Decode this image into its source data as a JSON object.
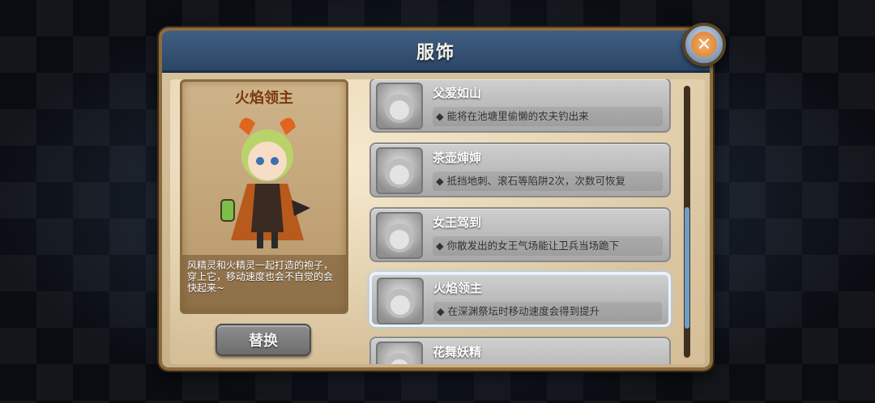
{
  "dialog": {
    "title": "服饰",
    "close_label": "✕"
  },
  "preview": {
    "name": "火焰领主",
    "description": "风精灵和火精灵一起打造的袍子，穿上它，移动速度也会不自觉的会快起来~"
  },
  "buttons": {
    "replace": "替换"
  },
  "items": [
    {
      "name": "父爱如山",
      "desc": "◆ 能将在池塘里偷懒的农夫钓出来"
    },
    {
      "name": "茶壶婶婶",
      "desc": "◆ 抵挡地刺、滚石等陷阱2次，次数可恢复"
    },
    {
      "name": "女王驾到",
      "desc": "◆ 你散发出的女王气场能让卫兵当场跪下"
    },
    {
      "name": "火焰领主",
      "desc": "◆ 在深渊祭坛时移动速度会得到提升"
    },
    {
      "name": "花舞妖精",
      "desc": ""
    }
  ],
  "colors": {
    "title_bar": "#3f5f82",
    "selected_border": "#e9f3ff",
    "scroll_thumb": "#6c9ec9"
  }
}
